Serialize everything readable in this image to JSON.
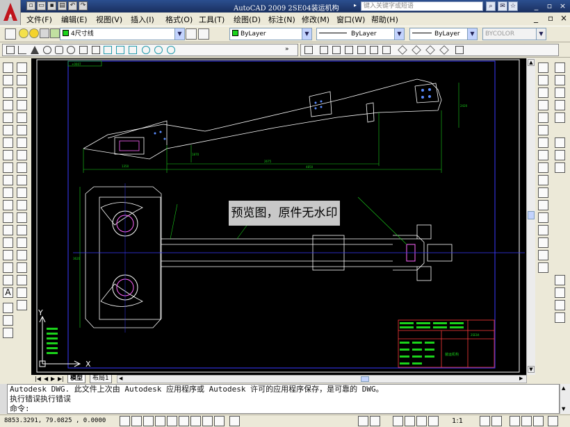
{
  "app": {
    "title": "AutoCAD 2009 2SE04装运机构",
    "search_placeholder": "键入关键字或短语"
  },
  "menu": [
    "文件(F)",
    "编辑(E)",
    "视图(V)",
    "插入(I)",
    "格式(O)",
    "工具(T)",
    "绘图(D)",
    "标注(N)",
    "修改(M)",
    "窗口(W)",
    "帮助(H)"
  ],
  "layers": {
    "current_layer": "4尺寸线",
    "color": "ByLayer",
    "linetype": "ByLayer",
    "lineweight": "ByLayer",
    "plotstyle": "BYCOLOR"
  },
  "drawing": {
    "dims_top": [
      "1350",
      "2675",
      "4850"
    ],
    "dims_side": [
      "1870",
      "2420"
    ],
    "dim_left": "3620",
    "title_block": {
      "name": "装运机构",
      "code": "2SE04"
    },
    "ucs": {
      "x": "X",
      "y": "Y"
    },
    "frame_label": "+0007"
  },
  "tabs": {
    "model": "模型",
    "layout1": "布局1"
  },
  "command_lines": [
    "Autodesk DWG.   此文件上次由 Autodesk 应用程序或 Autodesk 许可的应用程序保存，是可靠的 DWG。",
    "执行错误执行错误",
    "命令:"
  ],
  "status": {
    "coords": "8853.3291, 79.0825  , 0.0000",
    "scale": "1:1"
  },
  "watermark": "预览图，原件无水印",
  "colors": {
    "title_bg": "#1a2f5f",
    "canvas": "#000000",
    "drawing_line": "#ffffff",
    "dim_line": "#1bd31b",
    "accent_blue": "#0000ff",
    "pink": "#ff66ff"
  }
}
